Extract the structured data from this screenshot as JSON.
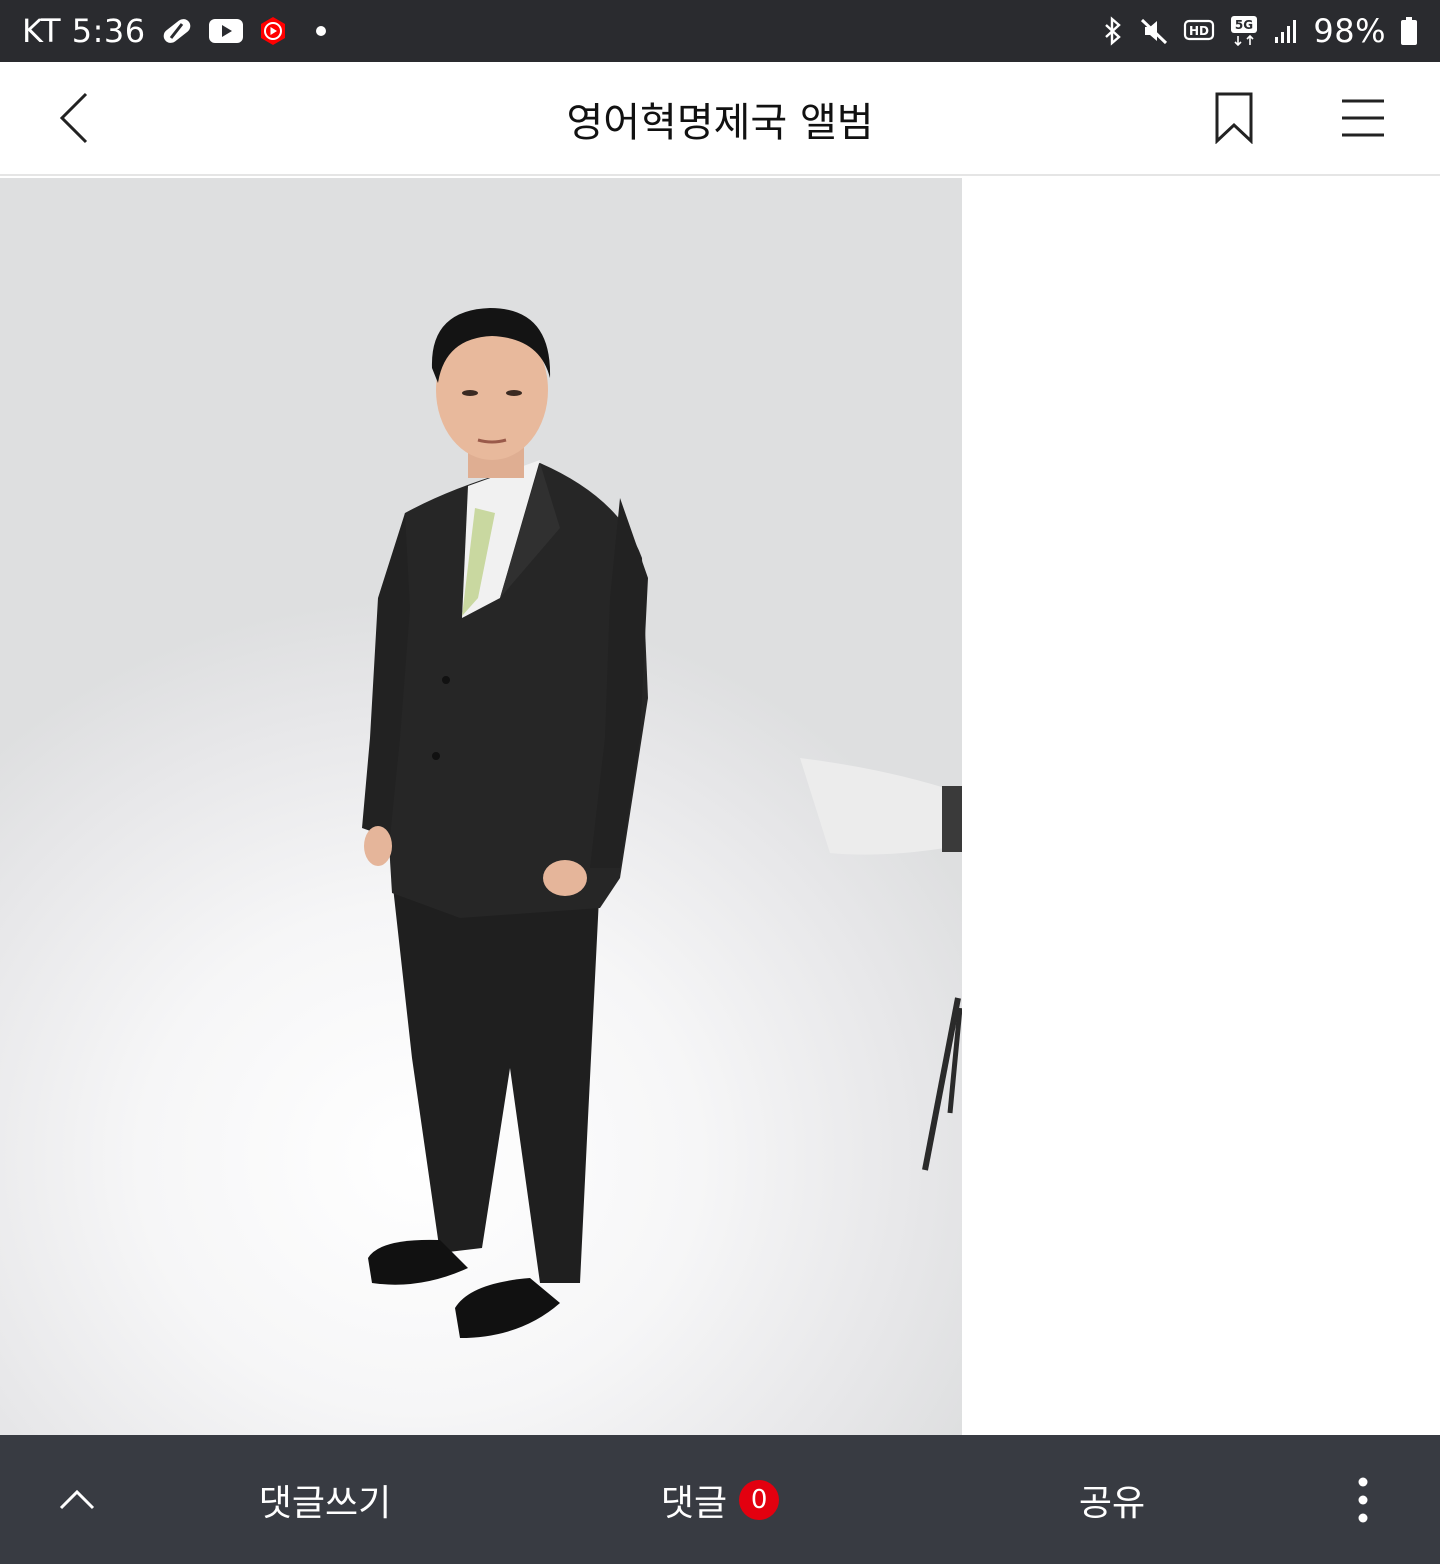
{
  "status_bar": {
    "carrier_time": "KT 5:36",
    "battery": "98%",
    "left_icons": [
      "pill-icon",
      "youtube-icon",
      "youtube-music-icon",
      "notification-dot"
    ],
    "right_icons": [
      "bluetooth-icon",
      "mute-icon",
      "hd-voice-icon",
      "5g-icon",
      "signal-icon",
      "battery-icon"
    ]
  },
  "header": {
    "title": "영어혁명제국 앨범",
    "icons": [
      "back-chevron-icon",
      "bookmark-icon",
      "hamburger-menu-icon"
    ]
  },
  "photo": {
    "subject": "man in dark pinstripe suit standing in photo studio",
    "icon": "album-photo"
  },
  "bottom_bar": {
    "write_comment": "댓글쓰기",
    "comments": "댓글",
    "comment_count": "0",
    "share": "공유",
    "icons": [
      "chevron-up-icon",
      "more-vertical-icon"
    ]
  },
  "colors": {
    "status_bar_bg": "#2a2b2f",
    "bottom_bar_bg": "#383b42",
    "badge_red": "#e3000f"
  }
}
